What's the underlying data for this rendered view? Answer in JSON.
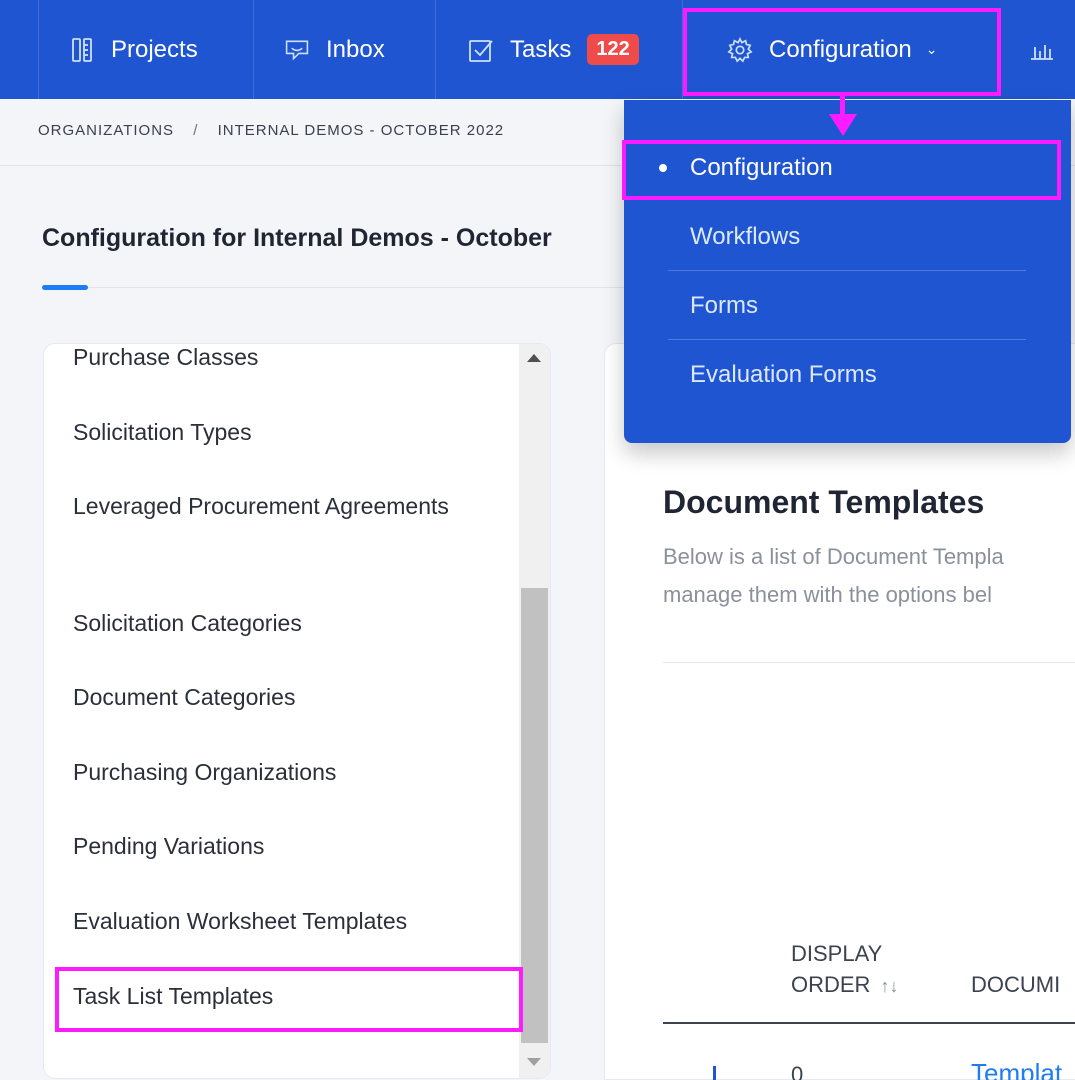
{
  "nav": {
    "projects": "Projects",
    "inbox": "Inbox",
    "tasks": "Tasks",
    "tasks_badge": "122",
    "configuration": "Configuration"
  },
  "breadcrumb": {
    "organizations": "ORGANIZATIONS",
    "separator": "/",
    "current": "INTERNAL DEMOS - OCTOBER 2022"
  },
  "page": {
    "title": "Configuration for Internal Demos - October"
  },
  "sidebar": {
    "items": [
      "Purchase Classes",
      "Solicitation Types",
      "Leveraged Procurement Agreements",
      "Solicitation Categories",
      "Document Categories",
      "Purchasing Organizations",
      "Pending Variations",
      "Evaluation Worksheet Templates",
      "Task List Templates"
    ]
  },
  "content": {
    "title": "Document Templates",
    "description_line1": "Below is a list of Document Templa",
    "description_line2": "manage them with the options bel",
    "table": {
      "col_order_line1": "DISPLAY",
      "col_order_line2": "ORDER",
      "col_document": "DOCUMI",
      "rows": [
        {
          "order": "0",
          "link": "Templat"
        }
      ]
    }
  },
  "dropdown": {
    "items": [
      "Configuration",
      "Workflows",
      "Forms",
      "Evaluation Forms"
    ]
  },
  "colors": {
    "nav_bg": "#1f55d1",
    "highlight": "#ff1bff",
    "link": "#1f7cf2",
    "badge": "#f04b4b"
  }
}
